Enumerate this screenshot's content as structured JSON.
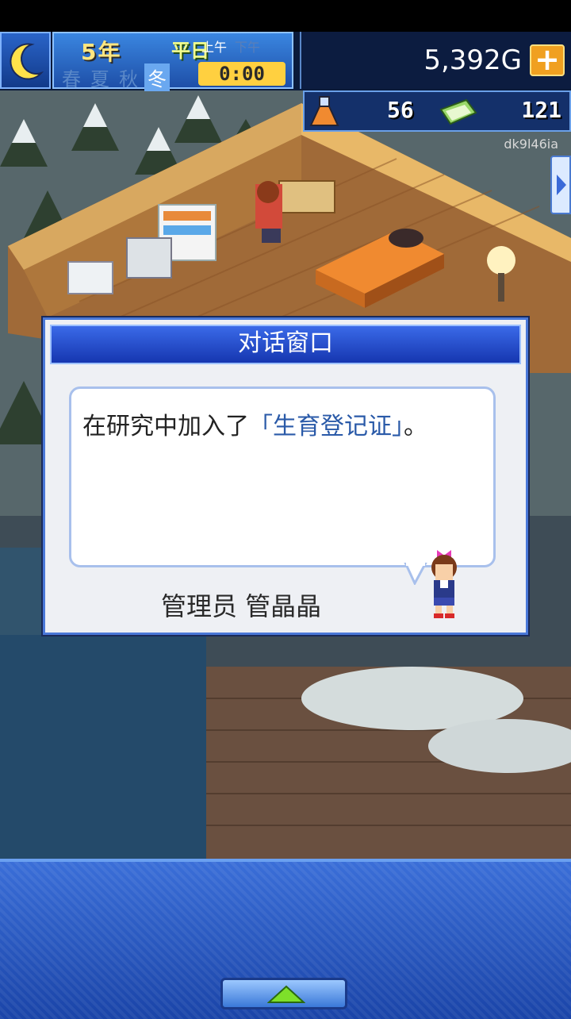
{
  "hud": {
    "year": "5年",
    "day_part": "平日",
    "seasons": [
      "春",
      "夏",
      "秋",
      "冬"
    ],
    "active_season": "冬",
    "am_label": "上午",
    "pm_label": "下午",
    "time": "0:00",
    "money": "5,392G",
    "research_points": "56",
    "cash_points": "121",
    "handle": "dk9l46ia"
  },
  "dialog": {
    "title": "对话窗口",
    "message_prefix": "在研究中加入了",
    "message_highlight": "「生育登记证」",
    "message_suffix": "。",
    "speaker": "管理员 管晶晶"
  },
  "colors": {
    "highlight_text": "#2a5aa8",
    "dialog_title_bg": "#1636b0",
    "bottom_bar": "#2a5cc8"
  }
}
